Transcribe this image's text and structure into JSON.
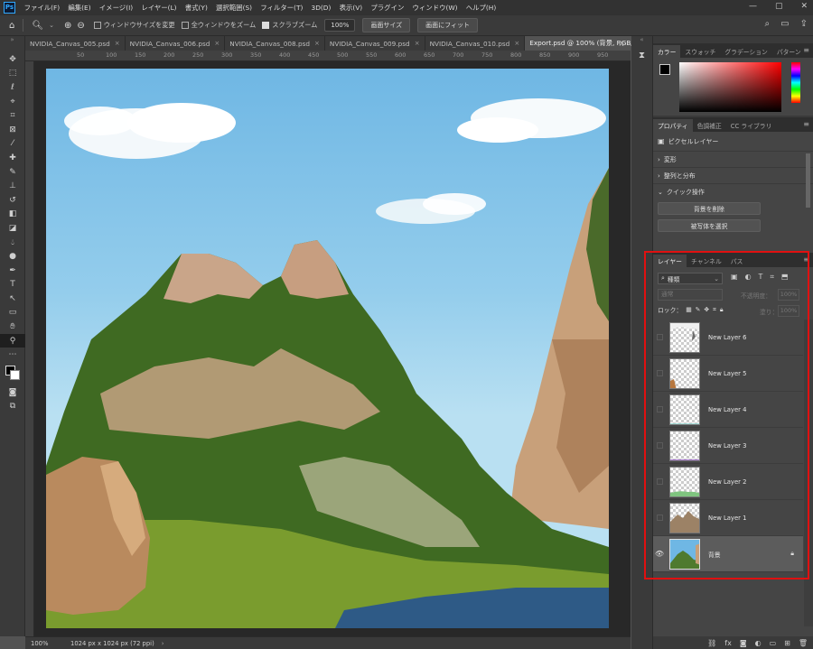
{
  "menubar": {
    "logo": "Ps",
    "items": [
      "ファイル(F)",
      "編集(E)",
      "イメージ(I)",
      "レイヤー(L)",
      "書式(Y)",
      "選択範囲(S)",
      "フィルター(T)",
      "3D(D)",
      "表示(V)",
      "プラグイン",
      "ウィンドウ(W)",
      "ヘルプ(H)"
    ],
    "minimize": "—",
    "maximize": "▢",
    "close": "✕"
  },
  "options": {
    "chk_resize": "ウィンドウサイズを変更",
    "chk_all": "全ウィンドウをズーム",
    "chk_scrubby": "スクラブズーム",
    "zoom_value": "100%",
    "btn_screen": "画面サイズ",
    "btn_fit": "画面にフィット"
  },
  "tabs": [
    {
      "label": "NVIDIA_Canvas_005.psd",
      "close": "×"
    },
    {
      "label": "NVIDIA_Canvas_006.psd",
      "close": "×"
    },
    {
      "label": "NVIDIA_Canvas_008.psd",
      "close": "×"
    },
    {
      "label": "NVIDIA_Canvas_009.psd",
      "close": "×"
    },
    {
      "label": "NVIDIA_Canvas_010.psd",
      "close": "×"
    },
    {
      "label": "Export.psd @ 100% (背景, RGB/8#) *",
      "close": "×"
    }
  ],
  "tab_more": "N",
  "ruler_labels": [
    "50",
    "100",
    "150",
    "200",
    "250",
    "300",
    "350",
    "400",
    "450",
    "500",
    "550",
    "600",
    "650",
    "700",
    "750",
    "800",
    "850",
    "900",
    "950"
  ],
  "status": {
    "zoom": "100%",
    "info": "1024 px x 1024 px (72 ppi)",
    "arrow": "›"
  },
  "color_panel": {
    "tabs": [
      "カラー",
      "スウォッチ",
      "グラデーション",
      "パターン"
    ],
    "hue_color": "#ff0000"
  },
  "props_panel": {
    "tabs": [
      "プロパティ",
      "色調補正",
      "CC ライブラリ"
    ],
    "type_label": "ピクセルレイヤー",
    "sections": [
      "変形",
      "整列と分布",
      "クイック操作"
    ],
    "btn_remove_bg": "背景を削除",
    "btn_select_subject": "被写体を選択"
  },
  "layers_panel": {
    "tabs": [
      "レイヤー",
      "チャンネル",
      "パス"
    ],
    "filter_kind": "種類",
    "blend_mode": "通常",
    "opacity_label": "不透明度：",
    "opacity_value": "100%",
    "lock_label": "ロック：",
    "fill_label": "塗り：",
    "fill_value": "100%",
    "layers": [
      {
        "name": "New Layer 6"
      },
      {
        "name": "New Layer 5"
      },
      {
        "name": "New Layer 4"
      },
      {
        "name": "New Layer 3"
      },
      {
        "name": "New Layer 2"
      },
      {
        "name": "New Layer 1"
      },
      {
        "name": "背景"
      }
    ]
  },
  "highlight_color": "#e01010"
}
